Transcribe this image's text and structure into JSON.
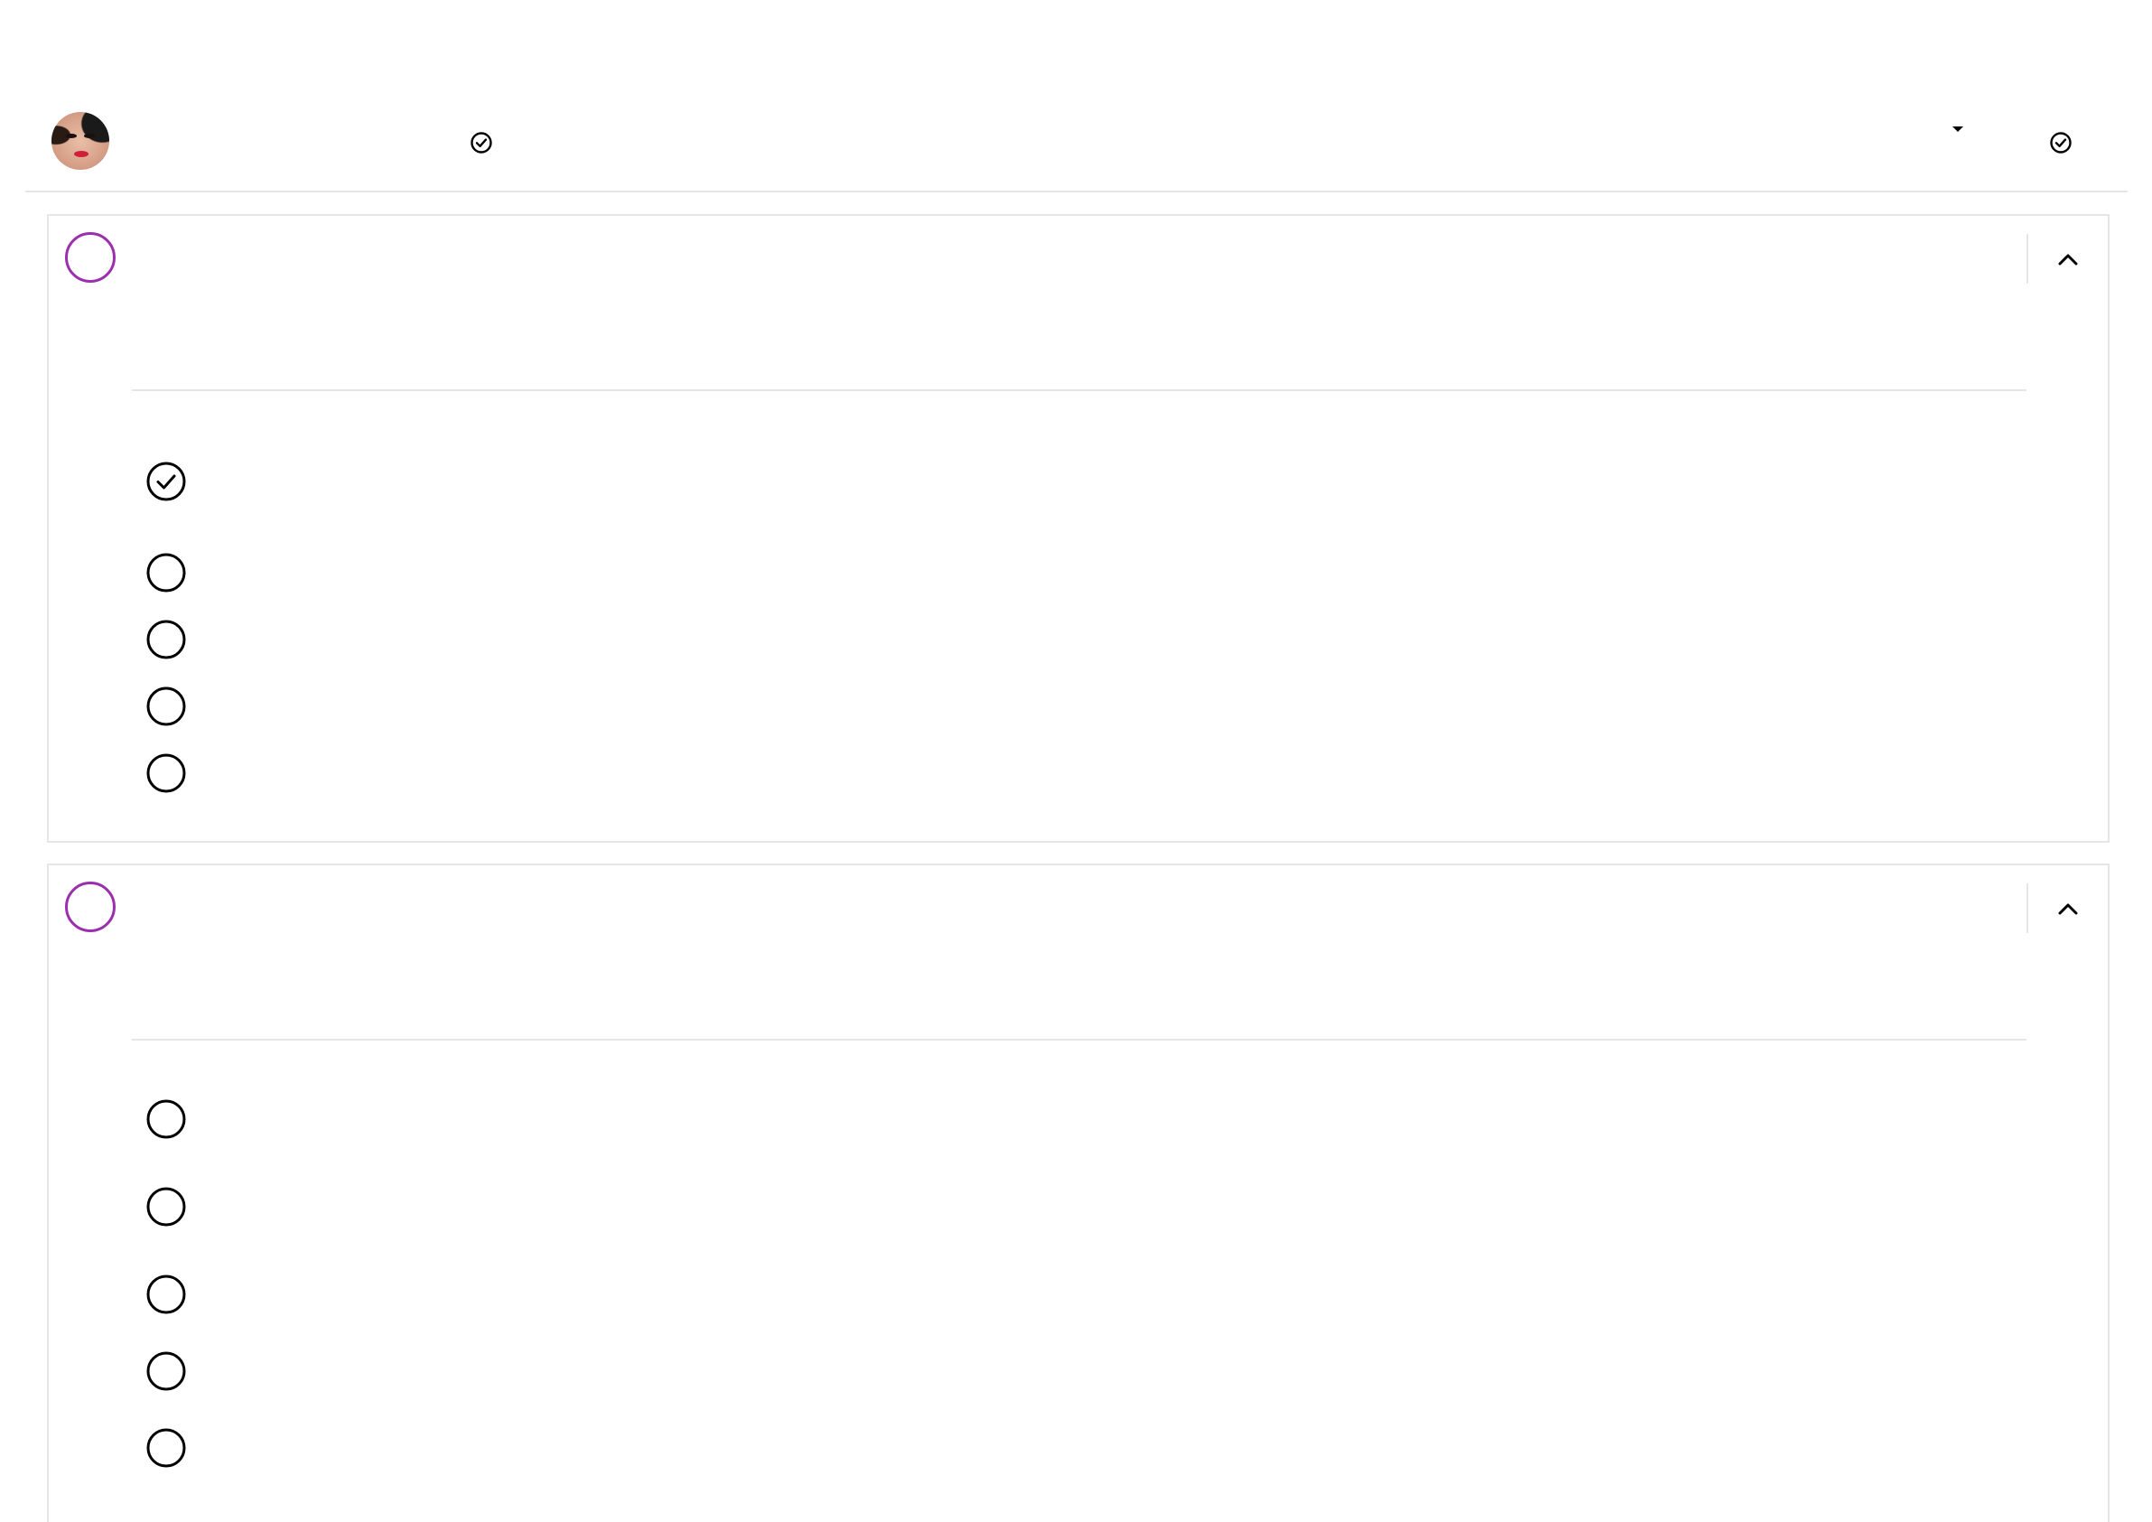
{
  "header": {
    "avatar_icon": "user-avatar",
    "status_icon": "check-circle-icon",
    "dropdown_icon": "caret-down-icon",
    "submit_icon": "check-circle-icon"
  },
  "questions": [
    {
      "collapse_icon": "chevron-up-icon",
      "options": [
        {
          "selected": true
        },
        {
          "selected": false
        },
        {
          "selected": false
        },
        {
          "selected": false
        },
        {
          "selected": false
        }
      ]
    },
    {
      "collapse_icon": "chevron-up-icon",
      "options": [
        {
          "selected": false
        },
        {
          "selected": false
        },
        {
          "selected": false
        },
        {
          "selected": false
        },
        {
          "selected": false
        }
      ]
    }
  ],
  "colors": {
    "accent": "#9b2fae",
    "border": "#e6e6e6",
    "icon": "#000000"
  }
}
